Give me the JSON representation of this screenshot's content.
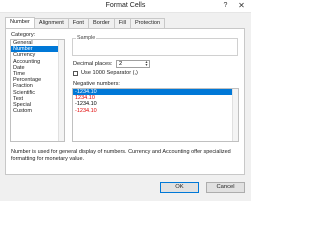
{
  "window": {
    "title": "Format Cells",
    "help_glyph": "?",
    "close_glyph": "✕"
  },
  "tabs": [
    {
      "label": "Number",
      "active": true
    },
    {
      "label": "Alignment",
      "active": false
    },
    {
      "label": "Font",
      "active": false
    },
    {
      "label": "Border",
      "active": false
    },
    {
      "label": "Fill",
      "active": false
    },
    {
      "label": "Protection",
      "active": false
    }
  ],
  "category": {
    "label": "Category:",
    "items": [
      "General",
      "Number",
      "Currency",
      "Accounting",
      "Date",
      "Time",
      "Percentage",
      "Fraction",
      "Scientific",
      "Text",
      "Special",
      "Custom"
    ],
    "selected": "Number"
  },
  "sample": {
    "label": "Sample"
  },
  "decimal_places": {
    "label": "Decimal places:",
    "value": "2"
  },
  "separator": {
    "label": "Use 1000 Separator (,)",
    "checked": false
  },
  "negative_numbers": {
    "label": "Negative numbers:",
    "items": [
      {
        "text": "-1234.10",
        "color": "#000000",
        "selected": true
      },
      {
        "text": "1234.10",
        "color": "#e00000",
        "selected": false
      },
      {
        "text": "-1234.10",
        "color": "#000000",
        "selected": false
      },
      {
        "text": "-1234.10",
        "color": "#e00000",
        "selected": false
      }
    ]
  },
  "description": "Number is used for general display of numbers.  Currency and Accounting offer specialized formatting for monetary value.",
  "buttons": {
    "ok": "OK",
    "cancel": "Cancel"
  },
  "colors": {
    "selection": "#0078d7",
    "negative_red": "#e00000"
  }
}
